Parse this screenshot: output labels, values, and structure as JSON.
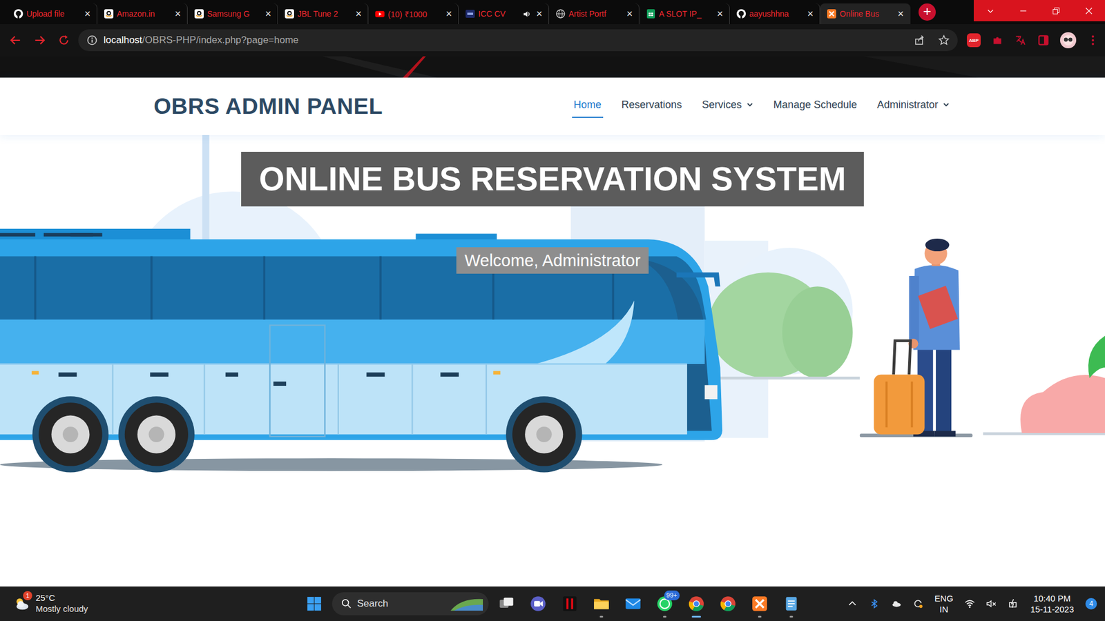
{
  "browser": {
    "tabs": [
      {
        "label": "Upload file",
        "kind": "github",
        "selected": false,
        "audio": false
      },
      {
        "label": "Amazon.in",
        "kind": "amazon",
        "selected": false,
        "audio": false
      },
      {
        "label": "Samsung G",
        "kind": "amazon",
        "selected": false,
        "audio": false
      },
      {
        "label": "JBL Tune 2",
        "kind": "amazon",
        "selected": false,
        "audio": false
      },
      {
        "label": "(10) ₹1000",
        "kind": "youtube",
        "selected": false,
        "audio": false
      },
      {
        "label": "ICC CV",
        "kind": "icc",
        "selected": false,
        "audio": true
      },
      {
        "label": "Artist Portf",
        "kind": "globe",
        "selected": false,
        "audio": false
      },
      {
        "label": "A SLOT IP_",
        "kind": "sheets",
        "selected": false,
        "audio": false
      },
      {
        "label": "aayushhna",
        "kind": "github",
        "selected": false,
        "audio": false
      },
      {
        "label": "Online Bus",
        "kind": "xampp",
        "selected": true,
        "audio": false
      }
    ],
    "close_glyph": "×",
    "new_tab": "+",
    "url": {
      "host": "localhost",
      "path": "/OBRS-PHP/index.php?page=home"
    },
    "adblock": "ABP"
  },
  "page": {
    "brand": "OBRS ADMIN PANEL",
    "nav": [
      {
        "label": "Home",
        "selected": true,
        "dropdown": false
      },
      {
        "label": "Reservations",
        "selected": false,
        "dropdown": false
      },
      {
        "label": "Services",
        "selected": false,
        "dropdown": true
      },
      {
        "label": "Manage Schedule",
        "selected": false,
        "dropdown": false
      },
      {
        "label": "Administrator",
        "selected": false,
        "dropdown": true
      }
    ],
    "hero_title": "ONLINE BUS RESERVATION SYSTEM",
    "welcome": "Welcome, Administrator"
  },
  "taskbar": {
    "weather": {
      "temp": "25°C",
      "condition": "Mostly cloudy",
      "badge": "1"
    },
    "search_placeholder": "Search",
    "apps": [
      {
        "kind": "taskview",
        "running": false,
        "selected": false,
        "badge": ""
      },
      {
        "kind": "meet",
        "running": false,
        "selected": false,
        "badge": ""
      },
      {
        "kind": "netflix",
        "running": false,
        "selected": false,
        "badge": ""
      },
      {
        "kind": "explorer",
        "running": true,
        "selected": false,
        "badge": ""
      },
      {
        "kind": "mail",
        "running": false,
        "selected": false,
        "badge": ""
      },
      {
        "kind": "whatsapp",
        "running": true,
        "selected": false,
        "badge": "99+"
      },
      {
        "kind": "chrome",
        "running": true,
        "selected": true,
        "badge": ""
      },
      {
        "kind": "chrome",
        "running": false,
        "selected": false,
        "badge": ""
      },
      {
        "kind": "xampp",
        "running": true,
        "selected": false,
        "badge": ""
      },
      {
        "kind": "notepad",
        "running": true,
        "selected": false,
        "badge": ""
      }
    ],
    "tray": {
      "lang": "ENG",
      "region": "IN",
      "time": "10:40 PM",
      "date": "15-11-2023",
      "notifications": "4",
      "volume_muted": true
    }
  }
}
